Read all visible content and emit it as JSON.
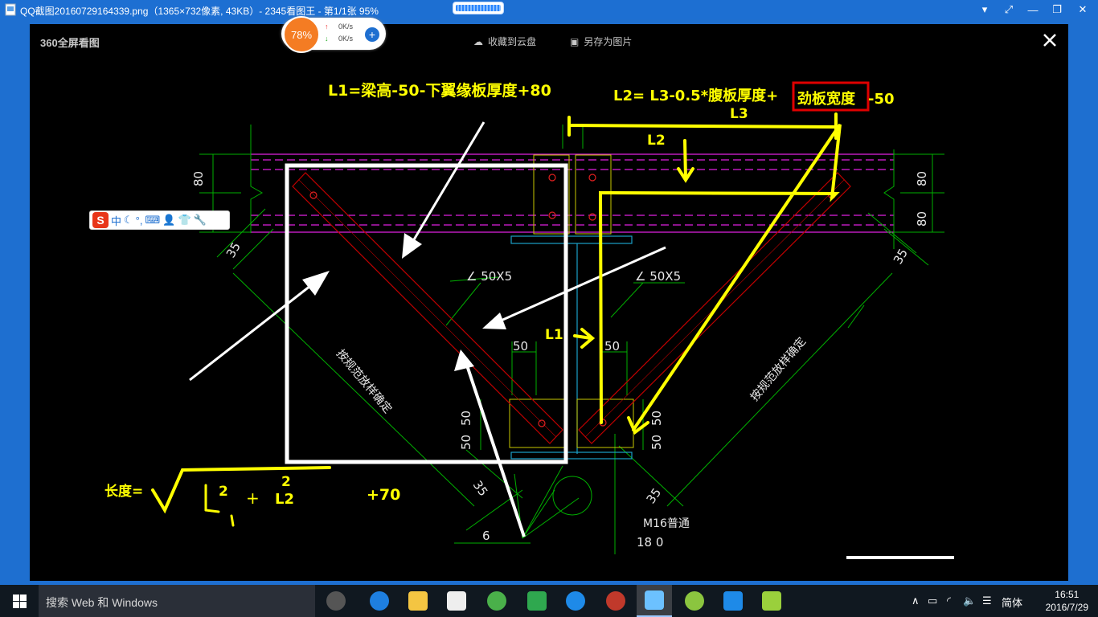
{
  "window": {
    "title": "QQ截图20160729164339.png（1365×732像素, 43KB）- 2345看图王 - 第1/1张 95%",
    "minimize": "▾",
    "fullscreen": "⤢",
    "restore": "❐",
    "close": "✕"
  },
  "viewer": {
    "brand": "360全屏看图",
    "save_cloud": "收藏到云盘",
    "save_as_image": "另存为图片"
  },
  "speed_widget": {
    "percent": "78%",
    "upload": "0K/s",
    "download": "0K/s"
  },
  "ime": {
    "logo": "S",
    "mode": "中"
  },
  "annotations": {
    "l1_formula": "L1=梁高-50-下翼缘板厚度+80",
    "l2_formula_a": "L2= L3-0.5*腹板厚度+",
    "l2_boxed": "劲板宽度",
    "l2_formula_b": "-50",
    "l3_label": "L3",
    "l2_label": "L2",
    "l1_label": "L1",
    "length_label": "长度=",
    "sq_1": "2",
    "sq_2": "2",
    "plus": "+",
    "l2_term": "L2",
    "plus_70": "+70"
  },
  "drawing_text": {
    "dim_80_left": "80",
    "dim_80_right_top": "80",
    "dim_80_right_bottom": "80",
    "dim_35_left_top": "35",
    "dim_35_right_top": "35",
    "angle_left": "∠ 50X5",
    "angle_right": "∠ 50X5",
    "dim_50_left": "50",
    "dim_50_right": "50",
    "dim_50_low_left_a": "50",
    "dim_50_low_left_b": "50",
    "dim_50_low_right_a": "50",
    "dim_50_low_right_b": "50",
    "diag_text_left": "按规范放样确定",
    "diag_text_right": "按规范放样确定",
    "dim_35_bottom_left": "35",
    "dim_35_bottom_right": "35",
    "dim_6": "6",
    "bolt_label": "M16普通",
    "dim_180": "18 0"
  },
  "taskbar": {
    "search_placeholder": "搜索 Web 和 Windows",
    "ime_lang": "简体",
    "time": "16:51",
    "date": "2016/7/29"
  },
  "colors": {
    "titlebar": "#1d6fd2",
    "annotation_yellow": "#ffff00",
    "cad_magenta": "#e020e0",
    "cad_green": "#00c000",
    "cad_red": "#c00000",
    "box_red": "#e00000"
  }
}
